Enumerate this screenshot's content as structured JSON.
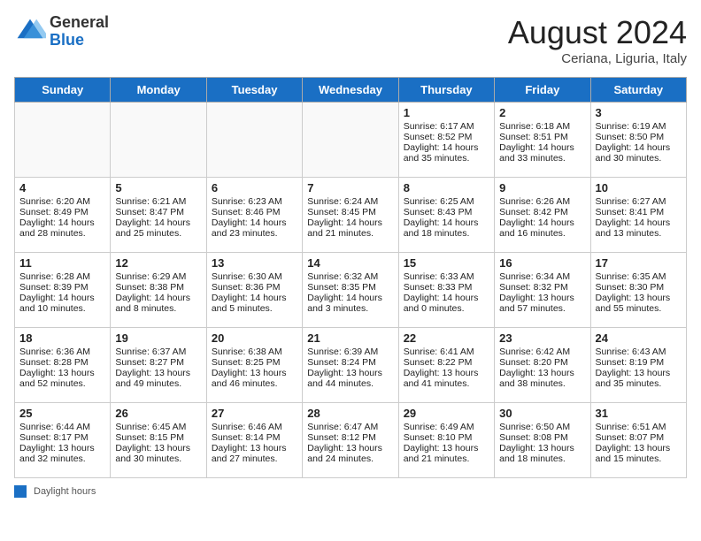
{
  "header": {
    "logo_general": "General",
    "logo_blue": "Blue",
    "month_year": "August 2024",
    "location": "Ceriana, Liguria, Italy"
  },
  "days_of_week": [
    "Sunday",
    "Monday",
    "Tuesday",
    "Wednesday",
    "Thursday",
    "Friday",
    "Saturday"
  ],
  "footer": {
    "label": "Daylight hours"
  },
  "weeks": [
    {
      "days": [
        {
          "num": "",
          "info": ""
        },
        {
          "num": "",
          "info": ""
        },
        {
          "num": "",
          "info": ""
        },
        {
          "num": "",
          "info": ""
        },
        {
          "num": "1",
          "info": "Sunrise: 6:17 AM\nSunset: 8:52 PM\nDaylight: 14 hours\nand 35 minutes."
        },
        {
          "num": "2",
          "info": "Sunrise: 6:18 AM\nSunset: 8:51 PM\nDaylight: 14 hours\nand 33 minutes."
        },
        {
          "num": "3",
          "info": "Sunrise: 6:19 AM\nSunset: 8:50 PM\nDaylight: 14 hours\nand 30 minutes."
        }
      ]
    },
    {
      "days": [
        {
          "num": "4",
          "info": "Sunrise: 6:20 AM\nSunset: 8:49 PM\nDaylight: 14 hours\nand 28 minutes."
        },
        {
          "num": "5",
          "info": "Sunrise: 6:21 AM\nSunset: 8:47 PM\nDaylight: 14 hours\nand 25 minutes."
        },
        {
          "num": "6",
          "info": "Sunrise: 6:23 AM\nSunset: 8:46 PM\nDaylight: 14 hours\nand 23 minutes."
        },
        {
          "num": "7",
          "info": "Sunrise: 6:24 AM\nSunset: 8:45 PM\nDaylight: 14 hours\nand 21 minutes."
        },
        {
          "num": "8",
          "info": "Sunrise: 6:25 AM\nSunset: 8:43 PM\nDaylight: 14 hours\nand 18 minutes."
        },
        {
          "num": "9",
          "info": "Sunrise: 6:26 AM\nSunset: 8:42 PM\nDaylight: 14 hours\nand 16 minutes."
        },
        {
          "num": "10",
          "info": "Sunrise: 6:27 AM\nSunset: 8:41 PM\nDaylight: 14 hours\nand 13 minutes."
        }
      ]
    },
    {
      "days": [
        {
          "num": "11",
          "info": "Sunrise: 6:28 AM\nSunset: 8:39 PM\nDaylight: 14 hours\nand 10 minutes."
        },
        {
          "num": "12",
          "info": "Sunrise: 6:29 AM\nSunset: 8:38 PM\nDaylight: 14 hours\nand 8 minutes."
        },
        {
          "num": "13",
          "info": "Sunrise: 6:30 AM\nSunset: 8:36 PM\nDaylight: 14 hours\nand 5 minutes."
        },
        {
          "num": "14",
          "info": "Sunrise: 6:32 AM\nSunset: 8:35 PM\nDaylight: 14 hours\nand 3 minutes."
        },
        {
          "num": "15",
          "info": "Sunrise: 6:33 AM\nSunset: 8:33 PM\nDaylight: 14 hours\nand 0 minutes."
        },
        {
          "num": "16",
          "info": "Sunrise: 6:34 AM\nSunset: 8:32 PM\nDaylight: 13 hours\nand 57 minutes."
        },
        {
          "num": "17",
          "info": "Sunrise: 6:35 AM\nSunset: 8:30 PM\nDaylight: 13 hours\nand 55 minutes."
        }
      ]
    },
    {
      "days": [
        {
          "num": "18",
          "info": "Sunrise: 6:36 AM\nSunset: 8:28 PM\nDaylight: 13 hours\nand 52 minutes."
        },
        {
          "num": "19",
          "info": "Sunrise: 6:37 AM\nSunset: 8:27 PM\nDaylight: 13 hours\nand 49 minutes."
        },
        {
          "num": "20",
          "info": "Sunrise: 6:38 AM\nSunset: 8:25 PM\nDaylight: 13 hours\nand 46 minutes."
        },
        {
          "num": "21",
          "info": "Sunrise: 6:39 AM\nSunset: 8:24 PM\nDaylight: 13 hours\nand 44 minutes."
        },
        {
          "num": "22",
          "info": "Sunrise: 6:41 AM\nSunset: 8:22 PM\nDaylight: 13 hours\nand 41 minutes."
        },
        {
          "num": "23",
          "info": "Sunrise: 6:42 AM\nSunset: 8:20 PM\nDaylight: 13 hours\nand 38 minutes."
        },
        {
          "num": "24",
          "info": "Sunrise: 6:43 AM\nSunset: 8:19 PM\nDaylight: 13 hours\nand 35 minutes."
        }
      ]
    },
    {
      "days": [
        {
          "num": "25",
          "info": "Sunrise: 6:44 AM\nSunset: 8:17 PM\nDaylight: 13 hours\nand 32 minutes."
        },
        {
          "num": "26",
          "info": "Sunrise: 6:45 AM\nSunset: 8:15 PM\nDaylight: 13 hours\nand 30 minutes."
        },
        {
          "num": "27",
          "info": "Sunrise: 6:46 AM\nSunset: 8:14 PM\nDaylight: 13 hours\nand 27 minutes."
        },
        {
          "num": "28",
          "info": "Sunrise: 6:47 AM\nSunset: 8:12 PM\nDaylight: 13 hours\nand 24 minutes."
        },
        {
          "num": "29",
          "info": "Sunrise: 6:49 AM\nSunset: 8:10 PM\nDaylight: 13 hours\nand 21 minutes."
        },
        {
          "num": "30",
          "info": "Sunrise: 6:50 AM\nSunset: 8:08 PM\nDaylight: 13 hours\nand 18 minutes."
        },
        {
          "num": "31",
          "info": "Sunrise: 6:51 AM\nSunset: 8:07 PM\nDaylight: 13 hours\nand 15 minutes."
        }
      ]
    }
  ]
}
